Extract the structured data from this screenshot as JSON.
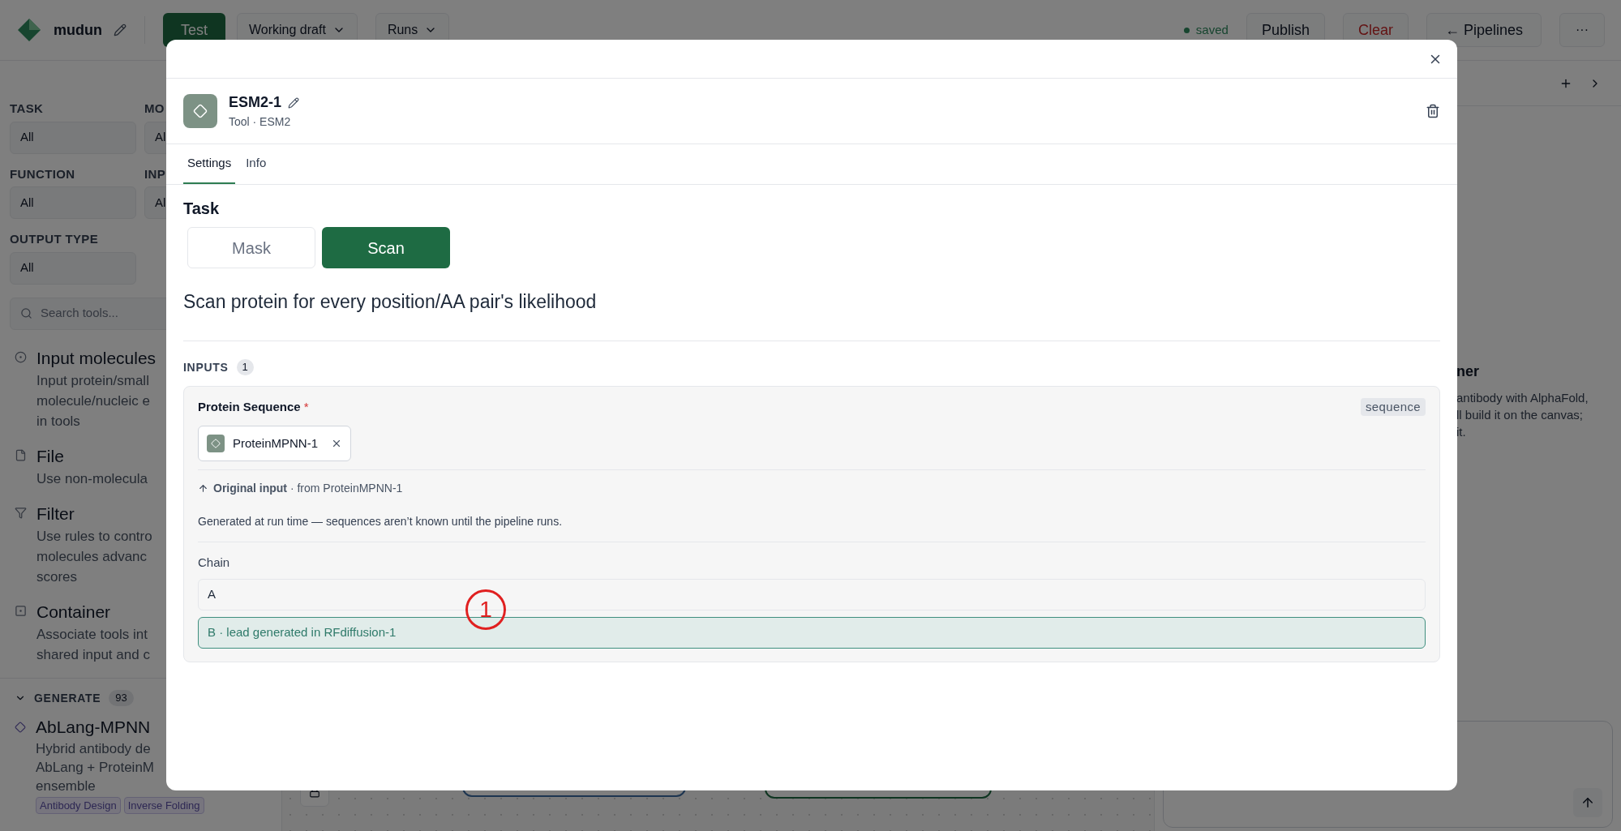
{
  "top_bar": {
    "app_name": "mudun",
    "test_button": "Test",
    "draft_menu": "Working draft",
    "runs_menu": "Runs",
    "save_status": "saved",
    "publish_button": "Publish",
    "clear_button": "Clear",
    "pipelines_button": "← Pipelines",
    "more_button": "···"
  },
  "sidebar": {
    "filters": [
      {
        "label": "TASK",
        "value": "All"
      },
      {
        "label": "MO",
        "value": "Al"
      },
      {
        "label": "FUNCTION",
        "value": "All"
      },
      {
        "label": "INP",
        "value": "Al"
      },
      {
        "label": "OUTPUT TYPE",
        "value": "All"
      }
    ],
    "search": {
      "placeholder": "Search tools..."
    },
    "items": [
      {
        "kind": "input",
        "title": "Input molecules",
        "lines": [
          "Input protein/small",
          "molecule/nucleic e",
          "in tools"
        ]
      },
      {
        "kind": "file",
        "title": "File",
        "lines": [
          "Use non-molecula"
        ]
      },
      {
        "kind": "filter",
        "title": "Filter",
        "lines": [
          "Use rules to contro",
          "molecules advanc",
          "scores"
        ]
      },
      {
        "kind": "container",
        "title": "Container",
        "lines": [
          "Associate tools int",
          "shared input and c"
        ]
      }
    ],
    "section": {
      "title": "GENERATE",
      "count": "93",
      "expanded": true
    },
    "tools": [
      {
        "title": "AbLang-MPNN",
        "lines": [
          "Hybrid antibody de",
          "AbLang + ProteinM",
          "ensemble"
        ],
        "tags": [
          "Antibody Design",
          "Inverse Folding"
        ]
      }
    ]
  },
  "right_panel": {
    "heading": "ner",
    "lines": [
      "antibody with AlphaFold,",
      "ll build it on the canvas;",
      "it."
    ]
  },
  "dialog": {
    "node_name": "ESM2-1",
    "subtitle": "Tool · ESM2",
    "tabs": [
      {
        "label": "Settings",
        "selected": true
      },
      {
        "label": "Info",
        "selected": false
      }
    ],
    "task": {
      "title": "Task",
      "options": [
        {
          "label": "Mask",
          "selected": false
        },
        {
          "label": "Scan",
          "selected": true
        }
      ],
      "description": "Scan protein for every position/AA pair's likelihood"
    },
    "inputs": {
      "title": "INPUTS",
      "count": "1",
      "items": [
        {
          "name": "Protein Sequence",
          "required_mark": "*",
          "type": "sequence",
          "sources": [
            {
              "label": "ProteinMPNN-1"
            }
          ],
          "origin": "**Original input** · from ProteinMPNN-1",
          "note": "Generated at run time — sequences aren’t known until the pipeline runs.",
          "chain": {
            "label": "Chain",
            "options": [
              {
                "label": "A",
                "selected": false
              },
              {
                "label": "B · lead generated in RFdiffusion-1",
                "selected": true
              }
            ]
          }
        }
      ]
    },
    "annotation": {
      "marker": "1"
    }
  }
}
